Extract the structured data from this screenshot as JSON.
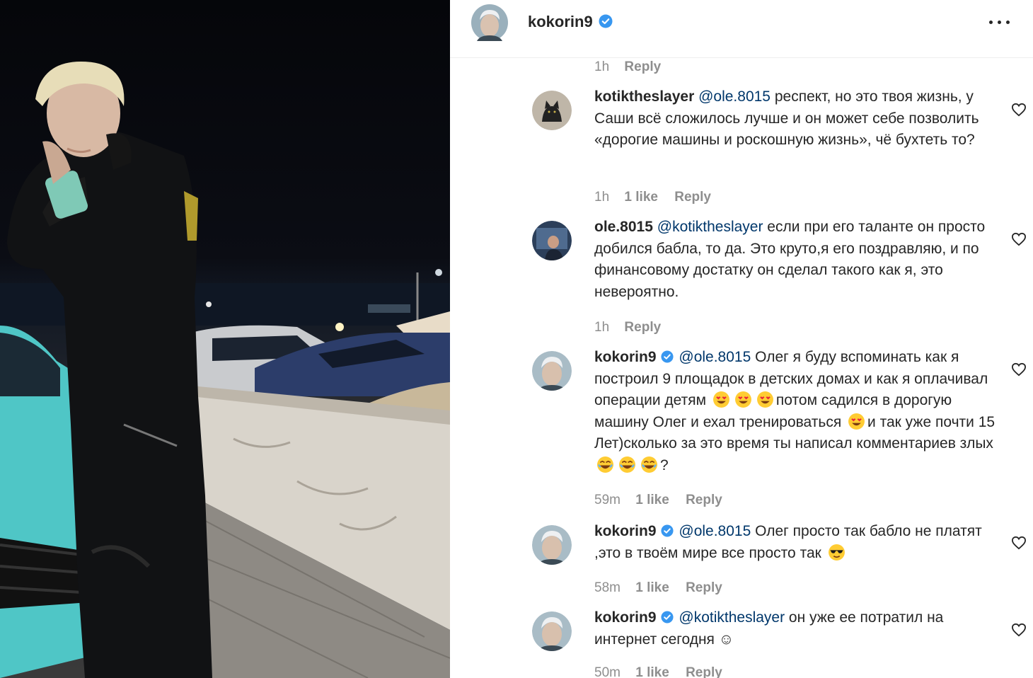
{
  "post": {
    "author": "kokorin9",
    "verified": true,
    "more_icon": "more-horizontal-icon"
  },
  "top_meta": {
    "time": "1h",
    "reply": "Reply"
  },
  "comments": [
    {
      "user": "kotiktheslayer",
      "verified": false,
      "mention": "@ole.8015",
      "text": " респект, но это твоя жизнь, у Саши всё сложилось лучше и он может себе позволить «дорогие машины и роскошную жизнь», чё бухтеть то?",
      "time": "1h",
      "likes": "1 like",
      "reply": "Reply"
    },
    {
      "user": "ole.8015",
      "verified": false,
      "mention": "@kotiktheslayer",
      "text": " если при его таланте он просто добился бабла, то да. Это круто,я его поздравляю, и по финансовому достатку он сделал такого как я, это невероятно.",
      "time": "1h",
      "likes": "",
      "reply": "Reply"
    },
    {
      "user": "kokorin9",
      "verified": true,
      "mention": "@ole.8015",
      "text_parts": [
        " Олег я буду вспоминать как я построил 9 площадок в детских домах и как я оплачивал операции детям ",
        "потом садился в дорогую машину Олег и ехал тренироваться ",
        "и так уже почти 15 Лет)сколько за это время ты написал комментариев злых",
        "?"
      ],
      "emoji_1": "heart-eyes-emoji",
      "emoji_2": "laughing-emoji",
      "time": "59m",
      "likes": "1 like",
      "reply": "Reply"
    },
    {
      "user": "kokorin9",
      "verified": true,
      "mention": "@ole.8015",
      "text": " Олег просто так бабло не платят ,это в твоём мире все просто так ",
      "emoji": "sunglasses-emoji",
      "time": "58m",
      "likes": "1 like",
      "reply": "Reply"
    },
    {
      "user": "kokorin9",
      "verified": true,
      "mention": "@kotiktheslayer",
      "text": " он уже ее потратил на интернет сегодня ☺",
      "time": "50m",
      "likes": "1 like",
      "reply": "Reply"
    }
  ],
  "colors": {
    "mention": "#00376b",
    "verified": "#3897f0",
    "meta": "#8e8e8e"
  }
}
